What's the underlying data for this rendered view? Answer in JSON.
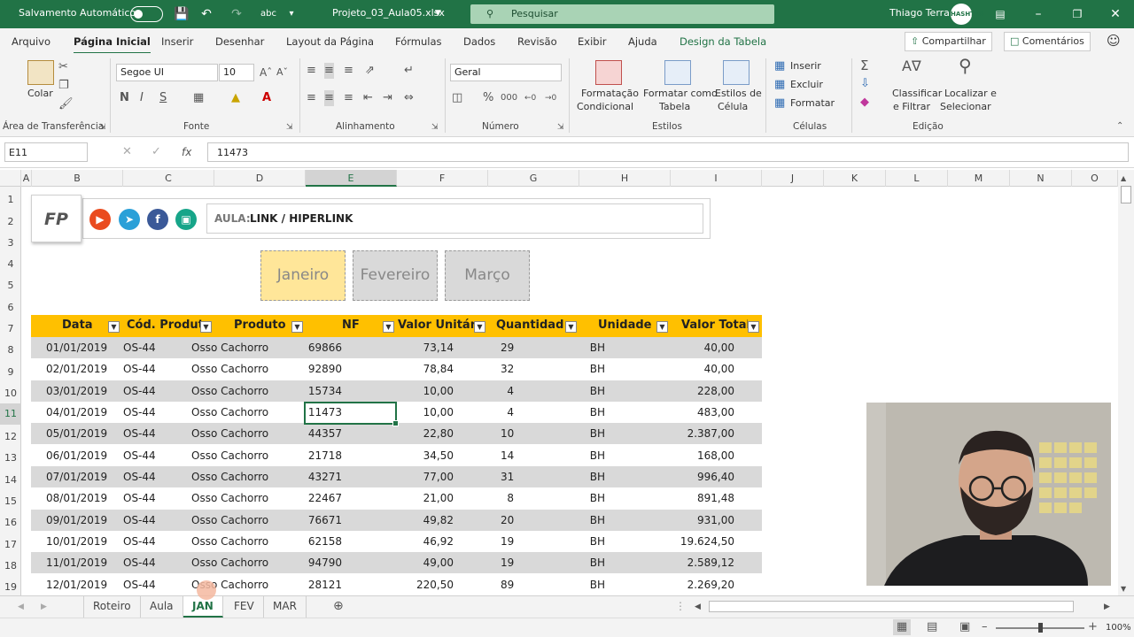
{
  "titlebar": {
    "autosave_label": "Salvamento Automático",
    "filename": "Projeto_03_Aula05.xlsx",
    "search_placeholder": "Pesquisar",
    "user_name": "Thiago Terra",
    "avatar_text": "HASHTAG"
  },
  "menu": {
    "items": [
      "Arquivo",
      "Página Inicial",
      "Inserir",
      "Desenhar",
      "Layout da Página",
      "Fórmulas",
      "Dados",
      "Revisão",
      "Exibir",
      "Ajuda",
      "Design da Tabela"
    ],
    "share": "Compartilhar",
    "comments": "Comentários"
  },
  "ribbon": {
    "paste": "Colar",
    "clipboard_group": "Área de Transferência",
    "font_name": "Segoe UI",
    "font_size": "10",
    "bold": "N",
    "italic": "I",
    "underline": "S",
    "font_group": "Fonte",
    "align_group": "Alinhamento",
    "number_format": "Geral",
    "number_group": "Número",
    "cond_format_1": "Formatação",
    "cond_format_2": "Condicional",
    "format_table_1": "Formatar como",
    "format_table_2": "Tabela",
    "cell_styles_1": "Estilos de",
    "cell_styles_2": "Célula",
    "styles_group": "Estilos",
    "insert": "Inserir",
    "delete": "Excluir",
    "format": "Formatar",
    "cells_group": "Células",
    "sort_1": "Classificar",
    "sort_2": "e Filtrar",
    "find_1": "Localizar e",
    "find_2": "Selecionar",
    "edit_group": "Edição"
  },
  "formula_bar": {
    "name_box": "E11",
    "fx": "fx",
    "value": "11473"
  },
  "columns": [
    "A",
    "B",
    "C",
    "D",
    "E",
    "F",
    "G",
    "H",
    "I",
    "J",
    "K",
    "L",
    "M",
    "N",
    "O"
  ],
  "rows": [
    "1",
    "2",
    "3",
    "4",
    "5",
    "6",
    "7",
    "8",
    "9",
    "10",
    "11",
    "12",
    "13",
    "14",
    "15",
    "16",
    "17",
    "18",
    "19"
  ],
  "sheet": {
    "logo": "FP",
    "aula_label": "AULA:",
    "aula_title": "LINK / HIPERLINK",
    "months": [
      "Janeiro",
      "Fevereiro",
      "Março"
    ],
    "headers": [
      "Data",
      "Cód. Produt",
      "Produto",
      "NF",
      "Valor Unitár",
      "Quantidad",
      "Unidade",
      "Valor Total"
    ],
    "data": [
      [
        "01/01/2019",
        "OS-44",
        "Osso Cachorro",
        "69866",
        "73,14",
        "29",
        "BH",
        "40,00"
      ],
      [
        "02/01/2019",
        "OS-44",
        "Osso Cachorro",
        "92890",
        "78,84",
        "32",
        "BH",
        "40,00"
      ],
      [
        "03/01/2019",
        "OS-44",
        "Osso Cachorro",
        "15734",
        "10,00",
        "4",
        "BH",
        "228,00"
      ],
      [
        "04/01/2019",
        "OS-44",
        "Osso Cachorro",
        "11473",
        "10,00",
        "4",
        "BH",
        "483,00"
      ],
      [
        "05/01/2019",
        "OS-44",
        "Osso Cachorro",
        "44357",
        "22,80",
        "10",
        "BH",
        "2.387,00"
      ],
      [
        "06/01/2019",
        "OS-44",
        "Osso Cachorro",
        "21718",
        "34,50",
        "14",
        "BH",
        "168,00"
      ],
      [
        "07/01/2019",
        "OS-44",
        "Osso Cachorro",
        "43271",
        "77,00",
        "31",
        "BH",
        "996,40"
      ],
      [
        "08/01/2019",
        "OS-44",
        "Osso Cachorro",
        "22467",
        "21,00",
        "8",
        "BH",
        "891,48"
      ],
      [
        "09/01/2019",
        "OS-44",
        "Osso Cachorro",
        "76671",
        "49,82",
        "20",
        "BH",
        "931,00"
      ],
      [
        "10/01/2019",
        "OS-44",
        "Osso Cachorro",
        "62158",
        "46,92",
        "19",
        "BH",
        "19.624,50"
      ],
      [
        "11/01/2019",
        "OS-44",
        "Osso Cachorro",
        "94790",
        "49,00",
        "19",
        "BH",
        "2.589,12"
      ],
      [
        "12/01/2019",
        "OS-44",
        "Osso Cachorro",
        "28121",
        "220,50",
        "89",
        "BH",
        "2.269,20"
      ]
    ]
  },
  "tabs": [
    "Roteiro",
    "Aula",
    "JAN",
    "FEV",
    "MAR"
  ],
  "active_tab": "JAN",
  "status": {
    "zoom": "100%"
  },
  "colors": {
    "excel_green": "#217346",
    "header_yellow": "#ffc000",
    "row_shade": "#d9d9d9",
    "janeiro_fill": "#ffe699"
  }
}
